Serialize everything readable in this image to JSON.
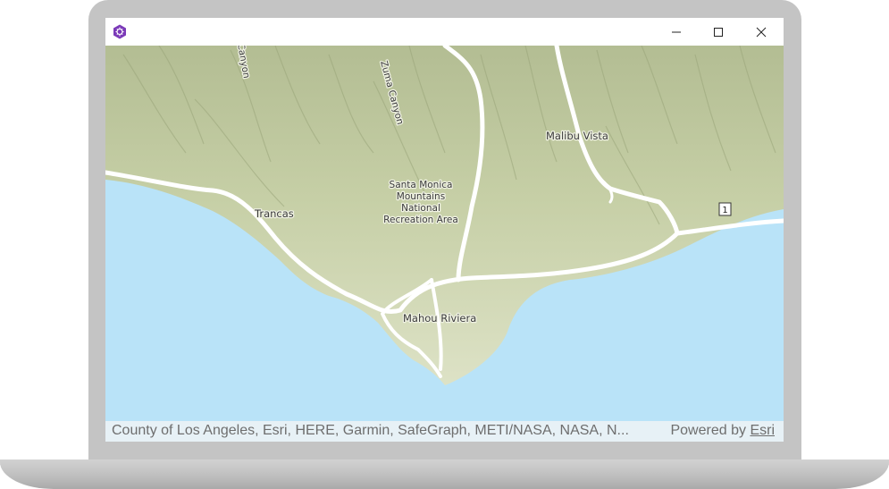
{
  "window": {
    "controls": {
      "minimize": "minimize-icon",
      "maximize": "maximize-icon",
      "close": "close-icon"
    },
    "app_icon": "app-logo-icon",
    "accent": "#7b3ab8"
  },
  "map": {
    "colors": {
      "water": "#b9e3f8",
      "land": "#d9dfc0",
      "roads": "#ffffff"
    },
    "labels": {
      "canyon_top": "Canyon",
      "zuma_canyon": "Zuma Canyon",
      "malibu_vista": "Malibu Vista",
      "park_line1": "Santa Monica",
      "park_line2": "Mountains",
      "park_line3": "National",
      "park_line4": "Recreation Area",
      "trancas": "Trancas",
      "mahou_riviera": "Mahou Riviera",
      "route_shield": "1"
    }
  },
  "attribution": {
    "sources": "County of Los Angeles, Esri, HERE, Garmin, SafeGraph, METI/NASA, NASA, N...",
    "powered_by": "Powered by",
    "esri": "Esri"
  }
}
